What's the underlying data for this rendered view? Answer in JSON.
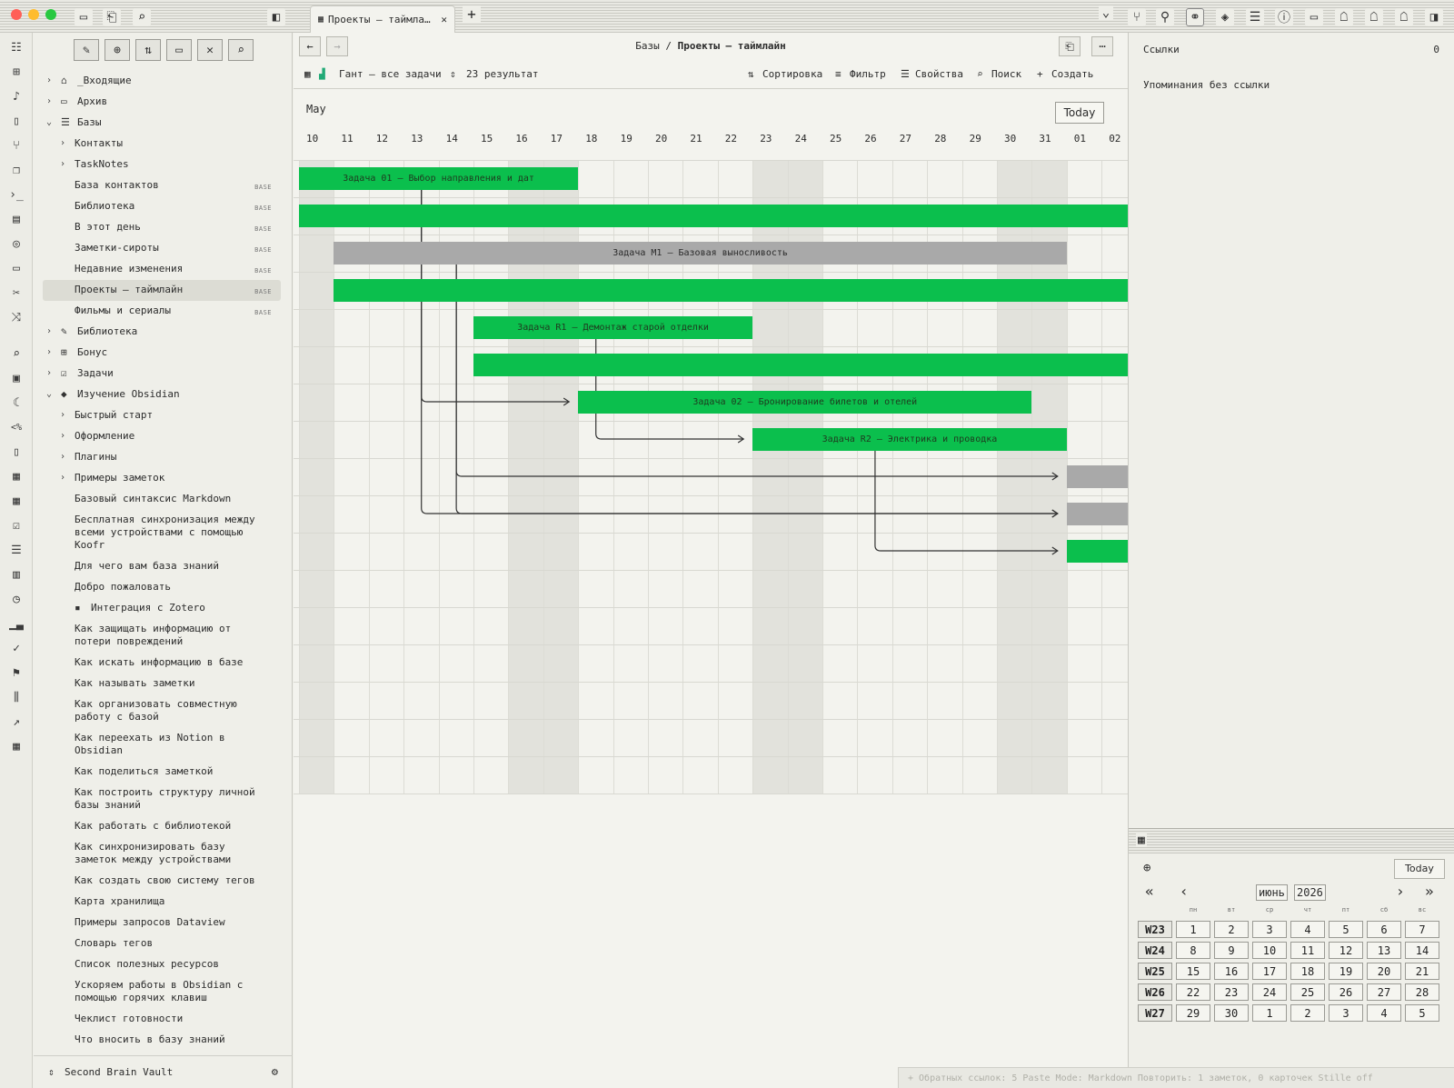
{
  "titlebar": {
    "tab_title": "Проекты — таймла…",
    "new_tab": "+",
    "close": "✕",
    "tab_list": "⌄"
  },
  "sidebar": {
    "tools": [
      "new-note",
      "new-folder",
      "sort",
      "collapse",
      "close",
      "search"
    ],
    "items": [
      {
        "label": "_Входящие",
        "level": 0,
        "chev": "›",
        "icon": "inbox-icon",
        "glyph": "⌂"
      },
      {
        "label": "Архив",
        "level": 0,
        "chev": "›",
        "icon": "archive-icon",
        "glyph": "▭"
      },
      {
        "label": "Базы",
        "level": 0,
        "chev": "⌄",
        "icon": "database-icon",
        "glyph": "☰"
      },
      {
        "label": "Контакты",
        "level": 1,
        "chev": "›"
      },
      {
        "label": "TaskNotes",
        "level": 1,
        "chev": "›"
      },
      {
        "label": "База контактов",
        "level": 1,
        "base": "BASE"
      },
      {
        "label": "Библиотека",
        "level": 1,
        "base": "BASE"
      },
      {
        "label": "В этот день",
        "level": 1,
        "base": "BASE"
      },
      {
        "label": "Заметки-сироты",
        "level": 1,
        "base": "BASE"
      },
      {
        "label": "Недавние изменения",
        "level": 1,
        "base": "BASE"
      },
      {
        "label": "Проекты — таймлайн",
        "level": 1,
        "base": "BASE",
        "active": true
      },
      {
        "label": "Фильмы и сериалы",
        "level": 1,
        "base": "BASE"
      },
      {
        "label": "Библиотека",
        "level": 0,
        "chev": "›",
        "icon": "books-icon",
        "glyph": "✎"
      },
      {
        "label": "Бонус",
        "level": 0,
        "chev": "›",
        "icon": "gift-icon",
        "glyph": "⊞"
      },
      {
        "label": "Задачи",
        "level": 0,
        "chev": "›",
        "icon": "tasks-icon",
        "glyph": "☑"
      },
      {
        "label": "Изучение Obsidian",
        "level": 0,
        "chev": "⌄",
        "icon": "obsidian-icon",
        "glyph": "◆"
      },
      {
        "label": "Быстрый старт",
        "level": 1,
        "chev": "›"
      },
      {
        "label": "Оформление",
        "level": 1,
        "chev": "›"
      },
      {
        "label": "Плагины",
        "level": 1,
        "chev": "›"
      },
      {
        "label": "Примеры заметок",
        "level": 1,
        "chev": "›"
      },
      {
        "label": "Базовый синтаксис Markdown",
        "level": 1
      },
      {
        "label": "Бесплатная синхронизация между всеми устройствами с помощью Koofr",
        "level": 1,
        "lines": 3
      },
      {
        "label": "Для чего вам база знаний",
        "level": 1
      },
      {
        "label": "Добро пожаловать",
        "level": 1
      },
      {
        "label": "Интеграция с Zotero",
        "level": 1,
        "icon": "zotero-icon",
        "glyph": "▪"
      },
      {
        "label": "Как защищать информацию от потери повреждений",
        "level": 1,
        "lines": 2
      },
      {
        "label": "Как искать информацию в базе",
        "level": 1
      },
      {
        "label": "Как называть заметки",
        "level": 1
      },
      {
        "label": "Как организовать совместную работу с базой",
        "level": 1,
        "lines": 2
      },
      {
        "label": "Как переехать из Notion в Obsidian",
        "level": 1,
        "lines": 2
      },
      {
        "label": "Как поделиться заметкой",
        "level": 1
      },
      {
        "label": "Как построить структуру личной базы знаний",
        "level": 1,
        "lines": 2
      },
      {
        "label": "Как работать с библиотекой",
        "level": 1
      },
      {
        "label": "Как синхронизировать базу заметок между устройствами",
        "level": 1,
        "lines": 2
      },
      {
        "label": "Как создать свою систему тегов",
        "level": 1
      },
      {
        "label": "Карта хранилища",
        "level": 1
      },
      {
        "label": "Примеры запросов Dataview",
        "level": 1
      },
      {
        "label": "Словарь тегов",
        "level": 1
      },
      {
        "label": "Список полезных ресурсов",
        "level": 1
      },
      {
        "label": "Ускоряем работы в Obsidian с помощью горячих клавиш",
        "level": 1,
        "lines": 2
      },
      {
        "label": "Чеклист готовности",
        "level": 1
      },
      {
        "label": "Что вносить в базу знаний",
        "level": 1
      }
    ],
    "vault_name": "Second Brain Vault"
  },
  "main": {
    "breadcrumb_parent": "Базы",
    "breadcrumb_sep": "/",
    "breadcrumb_current": "Проекты — таймлайн",
    "view_name": "Гант — все задачи",
    "results": "23 результат",
    "sort": "Сортировка",
    "filter": "Фильтр",
    "properties": "Свойства",
    "search": "Поиск",
    "create": "Создать"
  },
  "gantt": {
    "month": "May",
    "today_button": "Today",
    "days": [
      "10",
      "11",
      "12",
      "13",
      "14",
      "15",
      "16",
      "17",
      "18",
      "19",
      "20",
      "21",
      "22",
      "23",
      "24",
      "25",
      "26",
      "27",
      "28",
      "29",
      "30",
      "31",
      "01",
      "02"
    ],
    "weekend_days": [
      "10",
      "16",
      "17",
      "23",
      "24",
      "30",
      "31"
    ],
    "tasks": [
      {
        "label": "Задача 01 — Выбор направления и дат",
        "start": "10",
        "end": "17",
        "color": "green"
      },
      {
        "label": "",
        "start": "10",
        "end": "02",
        "color": "green"
      },
      {
        "label": "Задача M1 — Базовая выносливость",
        "start": "11",
        "end": "31",
        "color": "grey"
      },
      {
        "label": "",
        "start": "11",
        "end": "02",
        "color": "green"
      },
      {
        "label": "Задача R1 — Демонтаж старой отделки",
        "start": "15",
        "end": "22",
        "color": "green"
      },
      {
        "label": "",
        "start": "15",
        "end": "02",
        "color": "green"
      },
      {
        "label": "Задача 02 — Бронирование билетов и отелей",
        "start": "18",
        "end": "30",
        "color": "green"
      },
      {
        "label": "Задача R2 — Электрика и проводка",
        "start": "23",
        "end": "31",
        "color": "green"
      },
      {
        "label": "",
        "start": "01",
        "end": "02",
        "color": "grey"
      },
      {
        "label": "",
        "start": "01",
        "end": "02",
        "color": "grey"
      },
      {
        "label": "",
        "start": "01",
        "end": "02",
        "color": "green"
      }
    ]
  },
  "rightpanel": {
    "links_label": "Ссылки",
    "links_count": "0",
    "unlinked_label": "Упоминания без ссылки"
  },
  "calendar": {
    "today": "Today",
    "prev_year": "«",
    "prev_month": "‹",
    "next_month": "›",
    "next_year": "»",
    "month": "июнь",
    "year": "2026",
    "weekdays": [
      "пн",
      "вт",
      "ср",
      "чт",
      "пт",
      "сб",
      "вс"
    ],
    "weeks": [
      {
        "label": "W23",
        "days": [
          "1",
          "2",
          "3",
          "4",
          "5",
          "6",
          "7"
        ]
      },
      {
        "label": "W24",
        "days": [
          "8",
          "9",
          "10",
          "11",
          "12",
          "13",
          "14"
        ]
      },
      {
        "label": "W25",
        "days": [
          "15",
          "16",
          "17",
          "18",
          "19",
          "20",
          "21"
        ]
      },
      {
        "label": "W26",
        "days": [
          "22",
          "23",
          "24",
          "25",
          "26",
          "27",
          "28"
        ]
      },
      {
        "label": "W27",
        "days": [
          "29",
          "30",
          "1",
          "2",
          "3",
          "4",
          "5"
        ]
      }
    ]
  },
  "statusbar": {
    "text": "+ Обратных ссылок: 5 Paste Mode: Markdown Повторить: 1 заметок, 0 карточек Stille off"
  },
  "colors": {
    "green": "#0bbf4d",
    "grey": "#a9a9a9",
    "weekend": "#e2e2dc"
  }
}
